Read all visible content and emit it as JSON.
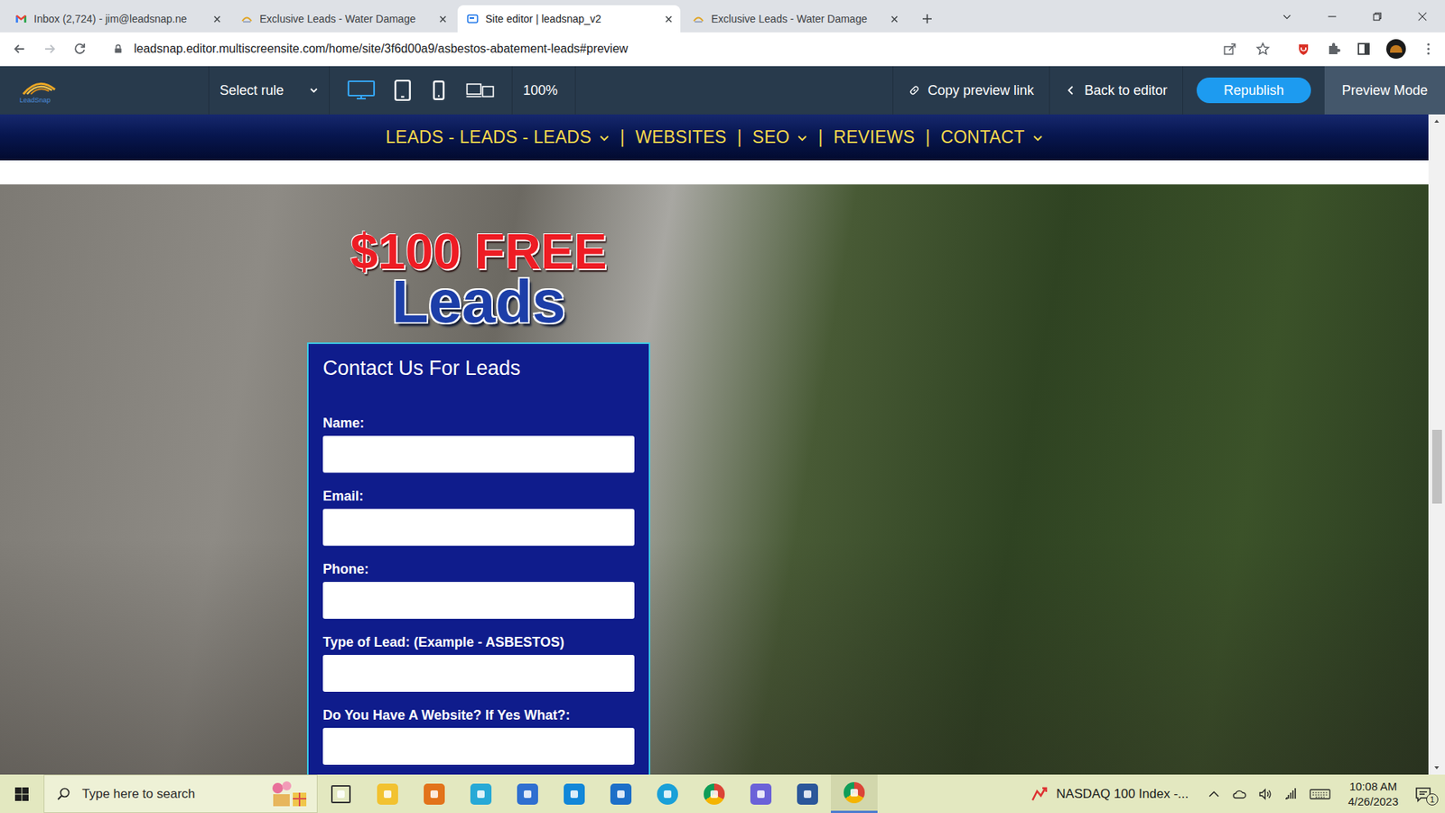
{
  "browser": {
    "tabs": [
      {
        "label": "Inbox (2,724) - jim@leadsnap.ne",
        "kind": "gmail",
        "selected": false
      },
      {
        "label": "Exclusive Leads - Water Damage",
        "kind": "site",
        "selected": false
      },
      {
        "label": "Site editor | leadsnap_v2",
        "kind": "editor",
        "selected": true
      },
      {
        "label": "Exclusive Leads - Water Damage",
        "kind": "site",
        "selected": false
      }
    ],
    "address": "leadsnap.editor.multiscreensite.com/home/site/3f6d00a9/asbestos-abatement-leads#preview"
  },
  "editor": {
    "logo": "LeadSnap",
    "select_rule": "Select rule",
    "devices": [
      {
        "kind": "desktop",
        "selected": true
      },
      {
        "kind": "tablet",
        "selected": false
      },
      {
        "kind": "phone",
        "selected": false
      },
      {
        "kind": "multi",
        "selected": false
      }
    ],
    "zoom": "100%",
    "copy_link": "Copy preview link",
    "back": "Back to editor",
    "republish": "Republish",
    "mode": "Preview Mode"
  },
  "site": {
    "nav": [
      {
        "label": "LEADS - LEADS - LEADS",
        "dropdown": true
      },
      {
        "label": "WEBSITES",
        "dropdown": false
      },
      {
        "label": "SEO",
        "dropdown": true
      },
      {
        "label": "REVIEWS",
        "dropdown": false
      },
      {
        "label": "CONTACT",
        "dropdown": true
      }
    ],
    "separator": "|",
    "promo": {
      "top": "$100 FREE",
      "bottom": "Leads"
    },
    "form": {
      "title": "Contact Us For Leads",
      "fields": [
        {
          "label": "Name:"
        },
        {
          "label": "Email:"
        },
        {
          "label": "Phone:"
        },
        {
          "label": "Type of Lead: (Example - ASBESTOS)"
        },
        {
          "label": "Do You Have A Website? If Yes What?:"
        }
      ]
    },
    "scroll": {
      "level": 0.54
    }
  },
  "taskbar": {
    "search": "Type here to search",
    "apps": [
      {
        "kind": "taskview",
        "active": false
      },
      {
        "kind": "explorer",
        "active": false
      },
      {
        "kind": "paint",
        "active": false
      },
      {
        "kind": "launcher",
        "active": false
      },
      {
        "kind": "store",
        "active": false
      },
      {
        "kind": "outlook",
        "active": false
      },
      {
        "kind": "mail",
        "active": false
      },
      {
        "kind": "edge",
        "active": false
      },
      {
        "kind": "chrome",
        "active": false
      },
      {
        "kind": "teams",
        "active": false
      },
      {
        "kind": "word",
        "active": false
      },
      {
        "kind": "chrome",
        "active": true
      }
    ],
    "widget": "NASDAQ 100 Index -...",
    "time": "10:08 AM",
    "date": "4/26/2023",
    "notifications": "1"
  }
}
